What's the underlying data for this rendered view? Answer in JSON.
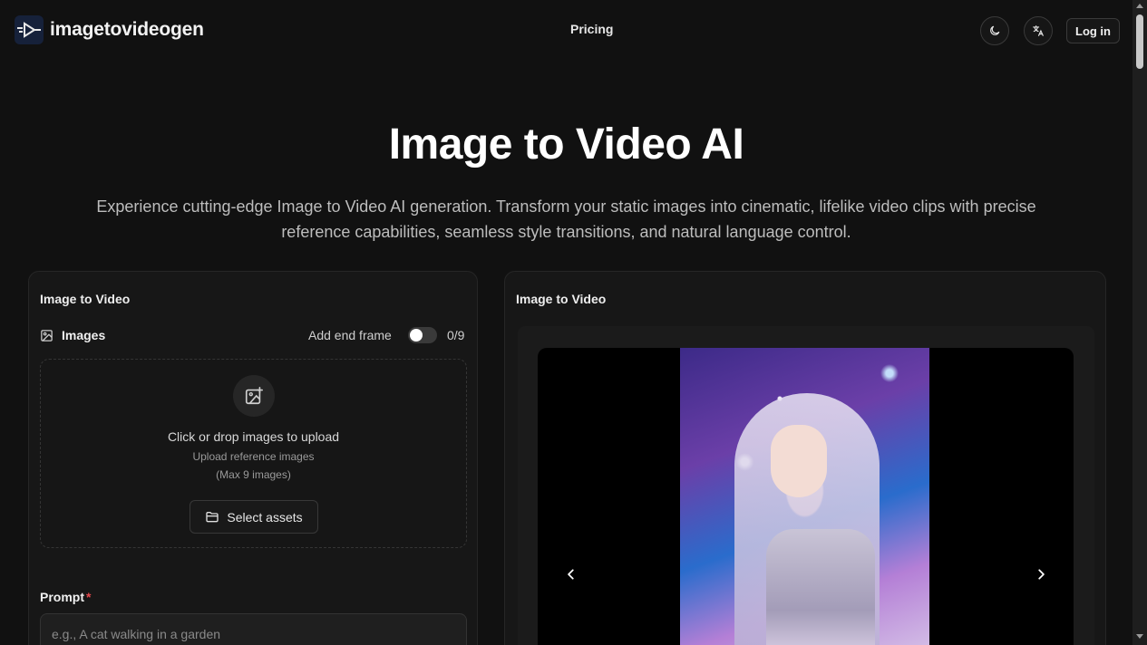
{
  "header": {
    "logo_text": "imagetovideogen",
    "nav_pricing": "Pricing",
    "theme_icon": "moon-icon",
    "language_icon": "translate-icon",
    "login_label": "Log in"
  },
  "hero": {
    "title": "Image to Video AI",
    "subtitle": "Experience cutting-edge Image to Video AI generation. Transform your static images into cinematic, lifelike video clips with precise reference capabilities, seamless style transitions, and natural language control."
  },
  "left_panel": {
    "title": "Image to Video",
    "images_label": "Images",
    "add_end_frame_label": "Add end frame",
    "add_end_frame_on": false,
    "image_count": "0/9",
    "dropzone": {
      "main": "Click or drop images to upload",
      "sub1": "Upload reference images",
      "sub2": "(Max 9 images)",
      "select_button": "Select assets"
    },
    "prompt": {
      "label": "Prompt",
      "required_mark": "*",
      "placeholder": "e.g., A cat walking in a garden",
      "value": ""
    }
  },
  "right_panel": {
    "title": "Image to Video"
  },
  "colors": {
    "background": "#111111",
    "panel": "#171717",
    "required": "#e5484d",
    "text": "#e8e8e8"
  }
}
